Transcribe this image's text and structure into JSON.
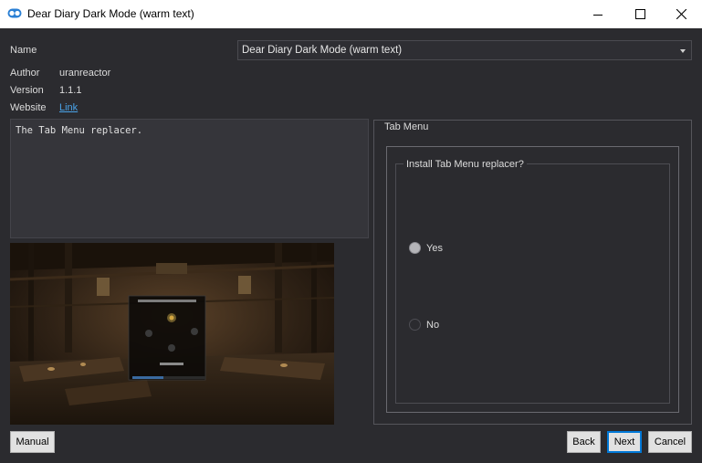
{
  "window": {
    "title": "Dear Diary Dark Mode (warm text)"
  },
  "info": {
    "name_label": "Name",
    "author_label": "Author",
    "author_value": "uranreactor",
    "version_label": "Version",
    "version_value": "1.1.1",
    "website_label": "Website",
    "website_link": "Link"
  },
  "combo": {
    "selected": "Dear Diary Dark Mode (warm text)"
  },
  "description": "The Tab Menu replacer.",
  "group": {
    "title": "Tab Menu",
    "question": "Install Tab Menu replacer?",
    "options": [
      {
        "label": "Yes",
        "checked": true
      },
      {
        "label": "No",
        "checked": false
      }
    ]
  },
  "buttons": {
    "manual": "Manual",
    "back": "Back",
    "next": "Next",
    "cancel": "Cancel"
  },
  "colors": {
    "background": "#2b2b2f",
    "link": "#4aa3e8",
    "default_button_border": "#0078d7"
  }
}
